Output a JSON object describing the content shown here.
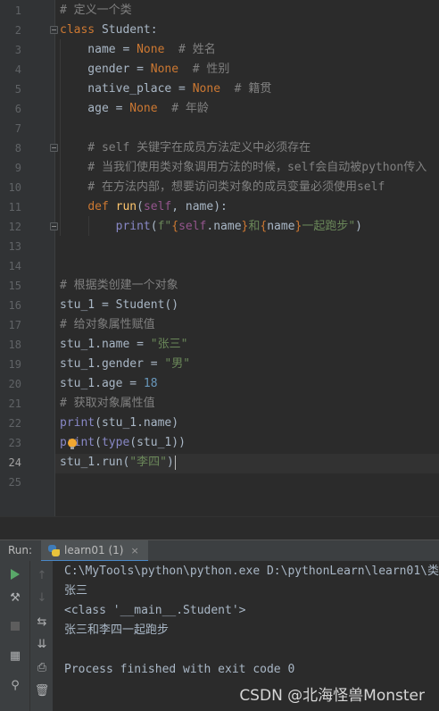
{
  "editor": {
    "line_numbers": [
      "1",
      "2",
      "3",
      "4",
      "5",
      "6",
      "7",
      "8",
      "9",
      "10",
      "11",
      "12",
      "13",
      "14",
      "15",
      "16",
      "17",
      "18",
      "19",
      "20",
      "21",
      "22",
      "23",
      "24",
      "25"
    ],
    "current_line": "24",
    "lines": [
      [
        {
          "t": "# 定义一个类",
          "c": "cmt"
        }
      ],
      [
        {
          "t": "class",
          "c": "kw"
        },
        {
          "t": " Student:",
          "c": "plain"
        }
      ],
      [
        {
          "t": "    name = ",
          "c": "plain"
        },
        {
          "t": "None",
          "c": "kw"
        },
        {
          "t": "  # 姓名",
          "c": "cmt"
        }
      ],
      [
        {
          "t": "    gender = ",
          "c": "plain"
        },
        {
          "t": "None",
          "c": "kw"
        },
        {
          "t": "  # 性别",
          "c": "cmt"
        }
      ],
      [
        {
          "t": "    native_place = ",
          "c": "plain"
        },
        {
          "t": "None",
          "c": "kw"
        },
        {
          "t": "  # 籍贯",
          "c": "cmt"
        }
      ],
      [
        {
          "t": "    age = ",
          "c": "plain"
        },
        {
          "t": "None",
          "c": "kw"
        },
        {
          "t": "  # 年龄",
          "c": "cmt"
        }
      ],
      [],
      [
        {
          "t": "    # self 关键字在成员方法定义中必须存在",
          "c": "cmt"
        }
      ],
      [
        {
          "t": "    # 当我们使用类对象调用方法的时候，self会自动被python传入",
          "c": "cmt"
        }
      ],
      [
        {
          "t": "    # 在方法内部，想要访问类对象的成员变量必须使用self",
          "c": "cmt"
        }
      ],
      [
        {
          "t": "    ",
          "c": "plain"
        },
        {
          "t": "def",
          "c": "kw"
        },
        {
          "t": " ",
          "c": "plain"
        },
        {
          "t": "run",
          "c": "def"
        },
        {
          "t": "(",
          "c": "plain"
        },
        {
          "t": "self",
          "c": "self"
        },
        {
          "t": ", name):",
          "c": "plain"
        }
      ],
      [
        {
          "t": "        ",
          "c": "plain"
        },
        {
          "t": "print",
          "c": "bi"
        },
        {
          "t": "(",
          "c": "plain"
        },
        {
          "t": "f\"",
          "c": "str"
        },
        {
          "t": "{",
          "c": "kw"
        },
        {
          "t": "self",
          "c": "self"
        },
        {
          "t": ".name",
          "c": "plain"
        },
        {
          "t": "}",
          "c": "kw"
        },
        {
          "t": "和",
          "c": "str"
        },
        {
          "t": "{",
          "c": "kw"
        },
        {
          "t": "name",
          "c": "plain"
        },
        {
          "t": "}",
          "c": "kw"
        },
        {
          "t": "一起跑步\"",
          "c": "str"
        },
        {
          "t": ")",
          "c": "plain"
        }
      ],
      [],
      [],
      [
        {
          "t": "# 根据类创建一个对象",
          "c": "cmt"
        }
      ],
      [
        {
          "t": "stu_1 = Student()",
          "c": "plain"
        }
      ],
      [
        {
          "t": "# 给对象属性赋值",
          "c": "cmt"
        }
      ],
      [
        {
          "t": "stu_1.name = ",
          "c": "plain"
        },
        {
          "t": "\"张三\"",
          "c": "str"
        }
      ],
      [
        {
          "t": "stu_1.gender = ",
          "c": "plain"
        },
        {
          "t": "\"男\"",
          "c": "str"
        }
      ],
      [
        {
          "t": "stu_1.age = ",
          "c": "plain"
        },
        {
          "t": "18",
          "c": "num"
        }
      ],
      [
        {
          "t": "# 获取对象属性值",
          "c": "cmt"
        }
      ],
      [
        {
          "t": "print",
          "c": "bi"
        },
        {
          "t": "(stu_1.name)",
          "c": "plain"
        }
      ],
      [
        {
          "t": "print",
          "c": "bi"
        },
        {
          "t": "(",
          "c": "plain"
        },
        {
          "t": "type",
          "c": "bi"
        },
        {
          "t": "(stu_1))",
          "c": "plain"
        }
      ],
      [
        {
          "t": "stu_1.run(",
          "c": "plain"
        },
        {
          "t": "\"李四\"",
          "c": "str"
        },
        {
          "t": ")",
          "c": "plain"
        }
      ],
      []
    ]
  },
  "run_panel": {
    "label": "Run:",
    "tab_label": "learn01 (1)",
    "tab_close": "×",
    "output": [
      "C:\\MyTools\\python\\python.exe D:\\pythonLearn\\learn01\\类",
      "张三",
      "<class '__main__.Student'>",
      "张三和李四一起跑步",
      "",
      "Process finished with exit code 0"
    ]
  },
  "toolbar_icons": {
    "left": [
      "run-icon",
      "wrench-icon",
      "stop-icon",
      "layout-icon",
      "pin-icon"
    ],
    "right": [
      "arrow-up-icon",
      "arrow-down-icon",
      "soft-wrap-icon",
      "scroll-to-end-icon",
      "print-icon",
      "trash-icon"
    ]
  },
  "colors": {
    "background": "#2b2b2b",
    "keyword": "#cc7832",
    "function_name": "#ffc66d",
    "self": "#94558d",
    "string": "#6a8759",
    "number": "#6897bb",
    "comment": "#808080",
    "builtin": "#8888c6",
    "run_green": "#59a869"
  },
  "watermark": "CSDN @北海怪兽Monster"
}
